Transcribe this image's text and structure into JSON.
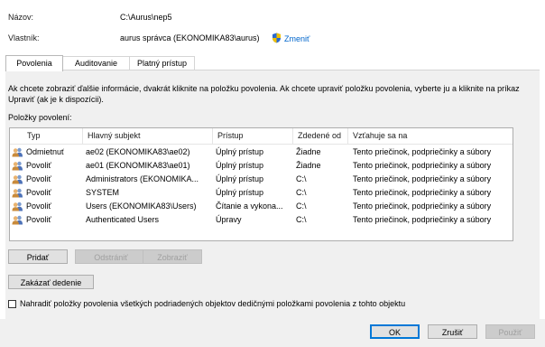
{
  "header": {
    "name_label": "Názov:",
    "name_value": "C:\\Aurus\\nep5",
    "owner_label": "Vlastník:",
    "owner_value": "aurus správca (EKONOMIKA83\\aurus)",
    "change_link": "Zmeniť"
  },
  "tabs": [
    {
      "label": "Povolenia",
      "active": true
    },
    {
      "label": "Auditovanie",
      "active": false
    },
    {
      "label": "Platný prístup",
      "active": false
    }
  ],
  "description": "Ak chcete zobraziť ďalšie informácie, dvakrát kliknite na položku povolenia. Ak chcete upraviť položku povolenia, vyberte ju a kliknite na príkaz Upraviť (ak je k dispozícii).",
  "entries_label": "Položky povolení:",
  "columns": {
    "type": "Typ",
    "principal": "Hlavný subjekt",
    "access": "Prístup",
    "inherited": "Zdedené od",
    "applies": "Vzťahuje sa na"
  },
  "rows": [
    {
      "type": "Odmietnuť",
      "principal": "ae02 (EKONOMIKA83\\ae02)",
      "access": "Úplný prístup",
      "inherited": "Žiadne",
      "applies": "Tento priečinok, podpriečinky a súbory"
    },
    {
      "type": "Povoliť",
      "principal": "ae01 (EKONOMIKA83\\ae01)",
      "access": "Úplný prístup",
      "inherited": "Žiadne",
      "applies": "Tento priečinok, podpriečinky a súbory"
    },
    {
      "type": "Povoliť",
      "principal": "Administrators (EKONOMIKA...",
      "access": "Úplný prístup",
      "inherited": "C:\\",
      "applies": "Tento priečinok, podpriečinky a súbory"
    },
    {
      "type": "Povoliť",
      "principal": "SYSTEM",
      "access": "Úplný prístup",
      "inherited": "C:\\",
      "applies": "Tento priečinok, podpriečinky a súbory"
    },
    {
      "type": "Povoliť",
      "principal": "Users (EKONOMIKA83\\Users)",
      "access": "Čítanie a vykona...",
      "inherited": "C:\\",
      "applies": "Tento priečinok, podpriečinky a súbory"
    },
    {
      "type": "Povoliť",
      "principal": "Authenticated Users",
      "access": "Úpravy",
      "inherited": "C:\\",
      "applies": "Tento priečinok, podpriečinky a súbory"
    }
  ],
  "buttons": {
    "add": "Pridať",
    "remove": "Odstrániť",
    "view": "Zobraziť",
    "disable_inheritance": "Zakázať dedenie",
    "ok": "OK",
    "cancel": "Zrušiť",
    "apply": "Použiť"
  },
  "replace_checkbox_label": "Nahradiť položky povolenia všetkých podriadených objektov dedičnými položkami povolenia z tohto objektu",
  "replace_checkbox_checked": false,
  "icons": {
    "shield": "uac-shield-icon",
    "user": "users-icon"
  }
}
